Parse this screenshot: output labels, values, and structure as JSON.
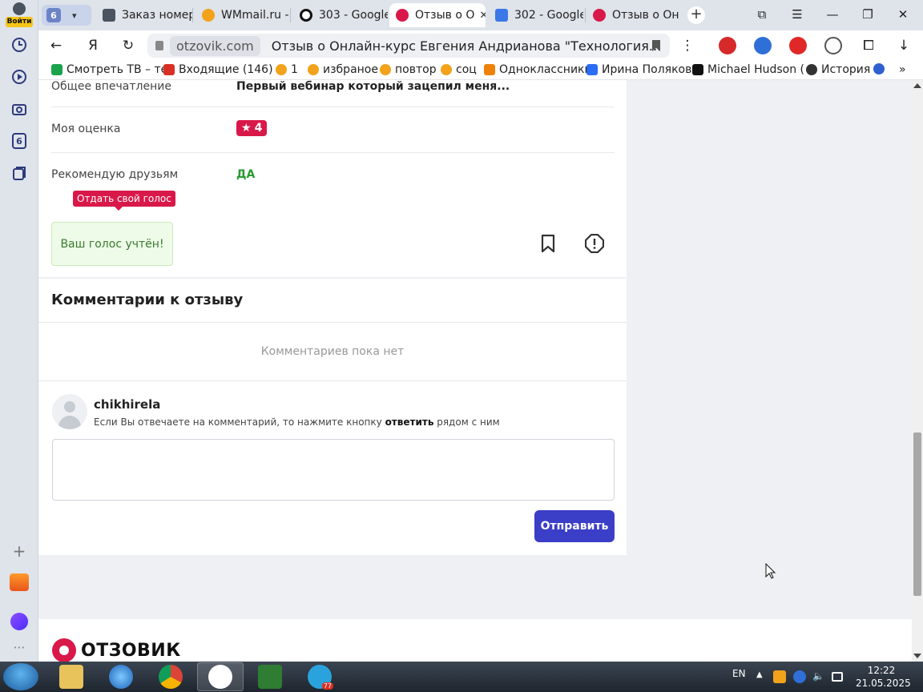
{
  "sidebar": {
    "login_label": "Войти",
    "icons": [
      "clock-icon",
      "play-icon",
      "camera-icon",
      "tab-count-icon",
      "collections-icon",
      "add-icon",
      "mail-icon",
      "alice-icon",
      "more-icon"
    ],
    "tab_count_badge": "6"
  },
  "tabs": {
    "group_count": "6",
    "items": [
      {
        "label": "Заказ номер",
        "favicon_color": "#4a5360"
      },
      {
        "label": "WMmail.ru -",
        "favicon_color": "#f2a21b"
      },
      {
        "label": "303 - Google",
        "favicon_color": "#111111"
      },
      {
        "label": "Отзыв о О",
        "favicon_color": "#d9184a",
        "active": true
      },
      {
        "label": "302 - Google",
        "favicon_color": "#3b78e7"
      },
      {
        "label": "Отзыв о Онл",
        "favicon_color": "#d9184a"
      }
    ]
  },
  "address": {
    "domain": "otzovik.com",
    "title": "Отзыв о Онлайн-курс Евгения Андрианова \"Технология..."
  },
  "bookmarks": [
    {
      "label": "Смотреть ТВ – те",
      "color": "#1aa34a"
    },
    {
      "label": "Входящие (146) -",
      "color": "#d93025"
    },
    {
      "label": "1",
      "color": "#f2a21b"
    },
    {
      "label": "избраное",
      "color": "#f2a21b"
    },
    {
      "label": "повтор",
      "color": "#f2a21b"
    },
    {
      "label": "соц",
      "color": "#f2a21b"
    },
    {
      "label": "Одноклассники",
      "color": "#ee8208"
    },
    {
      "label": "Ирина Полякова",
      "color": "#2a6df4"
    },
    {
      "label": "Michael Hudson (",
      "color": "#111111"
    },
    {
      "label": "История",
      "color": "#333333"
    }
  ],
  "review": {
    "impression_label": "Общее впечатление",
    "impression_value": "Первый вебинар который зацепил меня...",
    "rating_label": "Моя оценка",
    "rating_value": "4",
    "recommend_label": "Рекомендую друзьям",
    "recommend_value": "ДА",
    "vote_tooltip": "Отдать свой голос",
    "vote_status": "Ваш голос учтён!"
  },
  "comments": {
    "title": "Комментарии к отзыву",
    "empty_text": "Комментариев пока нет",
    "username": "chikhirela",
    "hint_before": "Если Вы отвечаете на комментарий, то нажмите кнопку ",
    "hint_bold": "ответить",
    "hint_after": " рядом с ним",
    "comment_value": "",
    "send_label": "Отправить"
  },
  "footer": {
    "logo_text": "ОТЗОВИК"
  },
  "taskbar": {
    "language": "EN",
    "time": "12:22",
    "date": "21.05.2025",
    "telegram_badge": "77"
  },
  "colors": {
    "brand": "#d9184a",
    "send_button": "#3b3ec7",
    "recommend": "#2a9a31",
    "vote_box_bg": "#edfbe8"
  }
}
